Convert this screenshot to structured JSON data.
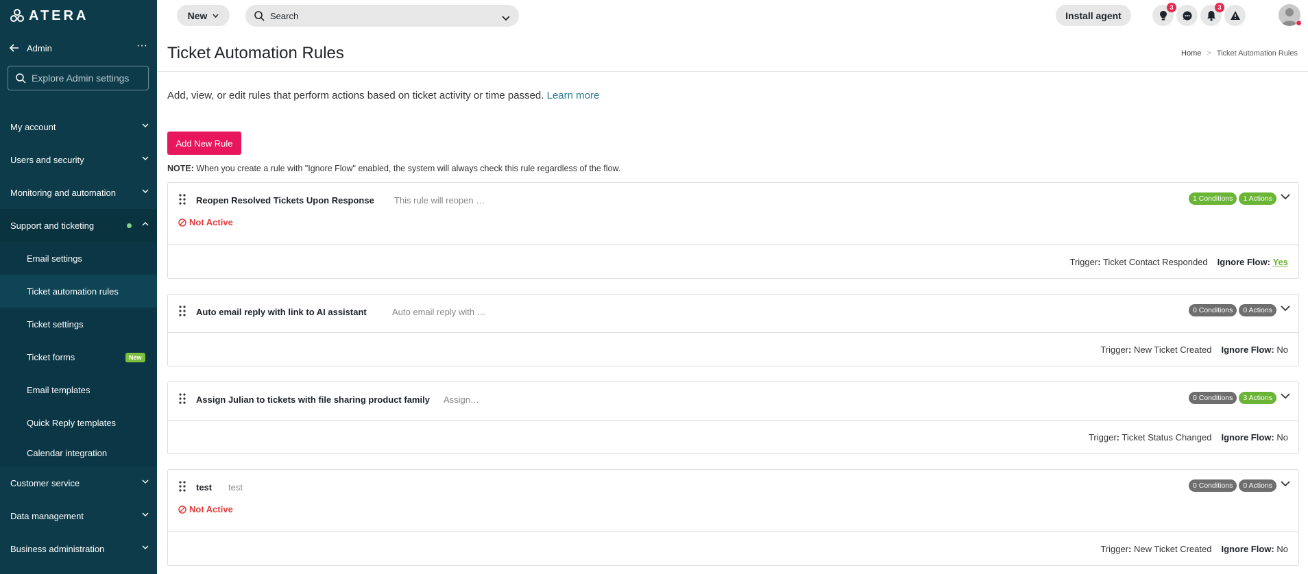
{
  "app": {
    "logo_text": "ATERA"
  },
  "sidebar": {
    "admin_label": "Admin",
    "search_placeholder": "Explore Admin settings",
    "sections": [
      {
        "label": "My account"
      },
      {
        "label": "Users and security"
      },
      {
        "label": "Monitoring and automation"
      },
      {
        "label": "Support and ticketing"
      },
      {
        "label": "Customer service"
      },
      {
        "label": "Data management"
      },
      {
        "label": "Business administration"
      }
    ],
    "support_items": [
      {
        "label": "Email settings"
      },
      {
        "label": "Ticket automation rules"
      },
      {
        "label": "Ticket settings"
      },
      {
        "label": "Ticket forms",
        "badge": "New"
      },
      {
        "label": "Email templates"
      },
      {
        "label": "Quick Reply templates"
      },
      {
        "label": "Calendar integration"
      }
    ]
  },
  "topbar": {
    "new_label": "New",
    "search_placeholder": "Search",
    "install_label": "Install agent",
    "tips_count": "3",
    "notifications_count": "3"
  },
  "page": {
    "title": "Ticket Automation Rules",
    "breadcrumb_home": "Home",
    "breadcrumb_sep": ">",
    "breadcrumb_current": "Ticket Automation Rules",
    "intro": "Add, view, or edit rules that perform actions based on ticket activity or time passed.",
    "learn_more": "Learn more",
    "add_button": "Add New Rule",
    "note_label": "NOTE:",
    "note_text": "When you create a rule with \"Ignore Flow\" enabled, the system will always check this rule regardless of the flow."
  },
  "labels": {
    "not_active": "Not Active",
    "trigger": "Trigger",
    "ignore_flow": "Ignore Flow"
  },
  "rules": [
    {
      "name": "Reopen Resolved Tickets Upon Response",
      "description": "This rule will reopen …",
      "conditions": "1 Conditions",
      "actions": "1 Actions",
      "trigger": "Ticket Contact Responded",
      "ignore_flow": "Yes"
    },
    {
      "name": "Auto email reply with link to AI assistant",
      "description": "Auto email reply with …",
      "conditions": "0 Conditions",
      "actions": "0 Actions",
      "trigger": "New Ticket Created",
      "ignore_flow": "No"
    },
    {
      "name": "Assign Julian to tickets with file sharing product family",
      "description": "Assign…",
      "conditions": "0 Conditions",
      "actions": "3 Actions",
      "trigger": "Ticket Status Changed",
      "ignore_flow": "No"
    },
    {
      "name": "test",
      "description": "test",
      "conditions": "0 Conditions",
      "actions": "0 Actions",
      "trigger": "New Ticket Created",
      "ignore_flow": "No"
    }
  ],
  "colors": {
    "sidebar_bg": "#0d3b4a",
    "accent": "#e8175d",
    "active_green": "#6bb536",
    "inactive_red": "#e23d3d"
  }
}
